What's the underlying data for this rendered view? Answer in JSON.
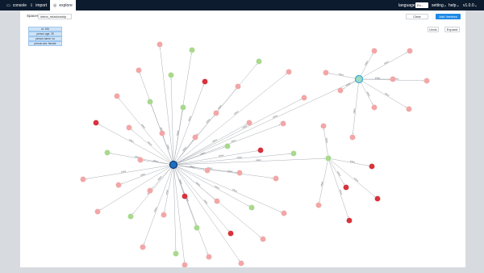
{
  "topbar": {
    "nav": [
      {
        "label": "console",
        "icon": "console-icon"
      },
      {
        "label": "import",
        "icon": "import-icon"
      },
      {
        "label": "explore",
        "icon": "explore-icon",
        "active": true
      }
    ],
    "language_label": "language",
    "language_value": "En...",
    "setting_label": "setting",
    "help_label": "help",
    "version": "v1.0.0"
  },
  "toolbar": {
    "spaces_label": "Spaces",
    "space_value": "infect_relationship",
    "clear_label": "Clear",
    "add_vertices_label": "Add Vertices",
    "undo_label": "Undo",
    "expand_label": "Expand"
  },
  "tooltip": {
    "lines": [
      "id: 106",
      "person.age: 25",
      "person.name: xu",
      "person.sex: female"
    ]
  },
  "edge_label": "infect",
  "colors": {
    "topbar": "#0d1b2e",
    "accent": "#1e8ae6",
    "node_pink": "#f3a6a6",
    "node_green": "#a8d98c",
    "node_red": "#d8323c",
    "node_blue": "#1f6fbf"
  }
}
